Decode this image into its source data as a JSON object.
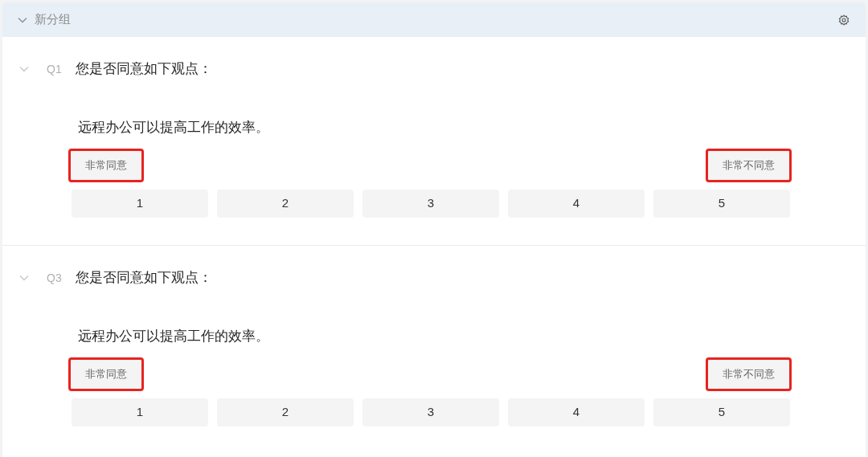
{
  "group": {
    "title": "新分组",
    "expanded": true
  },
  "questions": [
    {
      "number": "Q1",
      "title": "您是否同意如下观点：",
      "expanded": true,
      "statement": "远程办公可以提高工作的效率。",
      "labels": [
        {
          "text": "非常同意",
          "highlighted": true
        },
        {
          "text": "非常不同意",
          "highlighted": true
        }
      ],
      "options": [
        "1",
        "2",
        "3",
        "4",
        "5"
      ]
    },
    {
      "number": "Q3",
      "title": "您是否同意如下观点：",
      "expanded": true,
      "statement": "远程办公可以提高工作的效率。",
      "labels": [
        {
          "text": "非常同意",
          "highlighted": true
        },
        {
          "text": "非常不同意",
          "highlighted": true
        }
      ],
      "options": [
        "1",
        "2",
        "3",
        "4",
        "5"
      ]
    }
  ]
}
